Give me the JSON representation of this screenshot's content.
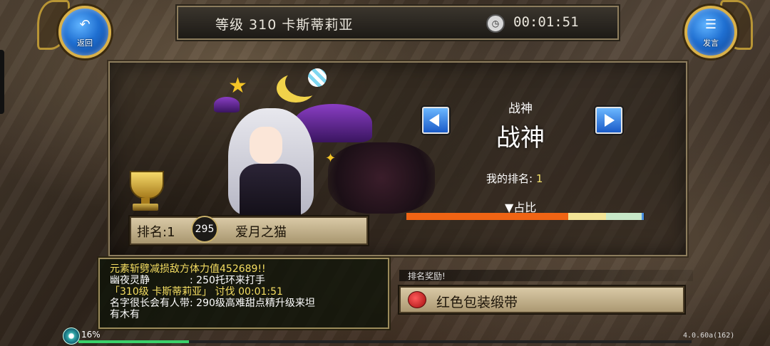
{
  "header": {
    "level_title": "等级 310 卡斯蒂莉亚",
    "timer": "00:01:51",
    "back_label": "返回",
    "chat_label": "发言"
  },
  "ranking": {
    "category_small": "战神",
    "category_big": "战神",
    "my_rank_label": "我的排名:",
    "my_rank_value": "1",
    "share_label": "▼占比",
    "rank_label": "排名:1",
    "player_level": "295",
    "player_name": "爱月之猫",
    "share_segments": [
      {
        "fraction": 0.68,
        "color": "#f06414"
      },
      {
        "fraction": 0.16,
        "color": "#f3e496"
      },
      {
        "fraction": 0.15,
        "color": "#c8e8c8"
      },
      {
        "fraction": 0.01,
        "color": "#4a90e2"
      }
    ]
  },
  "chat": {
    "lines": [
      "元素斩劈减损敌方体力值452689!!",
      "幽夜灵静　　　　: 250托环来打手",
      "「310级 卡斯蒂莉亚」 讨伐 00:01:51",
      "名字很长会有人带: 290级高难甜点精升级来坦",
      "有木有"
    ]
  },
  "reward": {
    "title": "排名奖励!",
    "item_name": "红色包装缎带"
  },
  "status": {
    "percent": "16%",
    "progress_fraction": 0.18,
    "version": "4.0.60a(162)"
  }
}
